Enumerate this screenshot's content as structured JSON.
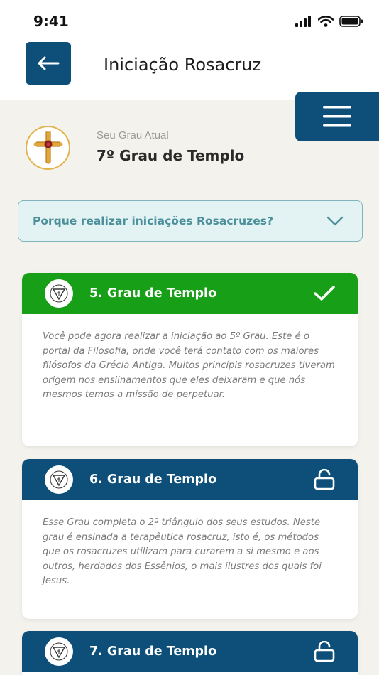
{
  "status_bar": {
    "time": "9:41"
  },
  "header": {
    "title": "Iniciação Rosacruz"
  },
  "current_grade": {
    "label": "Seu Grau Atual",
    "value": "7º Grau de Templo"
  },
  "faq": {
    "question": "Porque realizar iniciações Rosacruzes?"
  },
  "cards": [
    {
      "title": "5. Grau de Templo",
      "status": "completed",
      "header_color": "#17a017",
      "body": "Você pode agora realizar a iniciação ao 5º Grau. Este é o portal da Filosofia, onde você terá contato com os maiores filósofos da Grécia Antiga. Muitos princípis rosacruzes tiveram origem nos ensiinamentos que eles deixaram e que nós mesmos temos a missão de perpetuar."
    },
    {
      "title": "6. Grau de Templo",
      "status": "unlocked",
      "header_color": "#0d4f78",
      "body": "Esse Grau completa o 2º triângulo dos seus estudos. Neste grau é ensinada a terapêutica rosacruz, isto é, os métodos que os rosacruzes utilizam para curarem a si mesmo e aos outros, herdados dos Essênios, o mais ilustres dos quais foi Jesus."
    },
    {
      "title": "7. Grau de Templo",
      "status": "unlocked",
      "header_color": "#0d4f78",
      "body": ""
    }
  ],
  "colors": {
    "primary": "#0d4f78",
    "success": "#17a017",
    "background": "#f4f2ec",
    "faq_bg": "#e3f2f3",
    "faq_text": "#4a8f9a"
  },
  "icons": {
    "back": "arrow-left-icon",
    "menu": "hamburger-menu-icon",
    "emblem": "rosicrucian-cross-icon",
    "badge": "triangle-emblem-icon",
    "completed": "checkmark-icon",
    "unlocked": "unlocked-padlock-icon",
    "faq": "chevron-down-icon"
  }
}
